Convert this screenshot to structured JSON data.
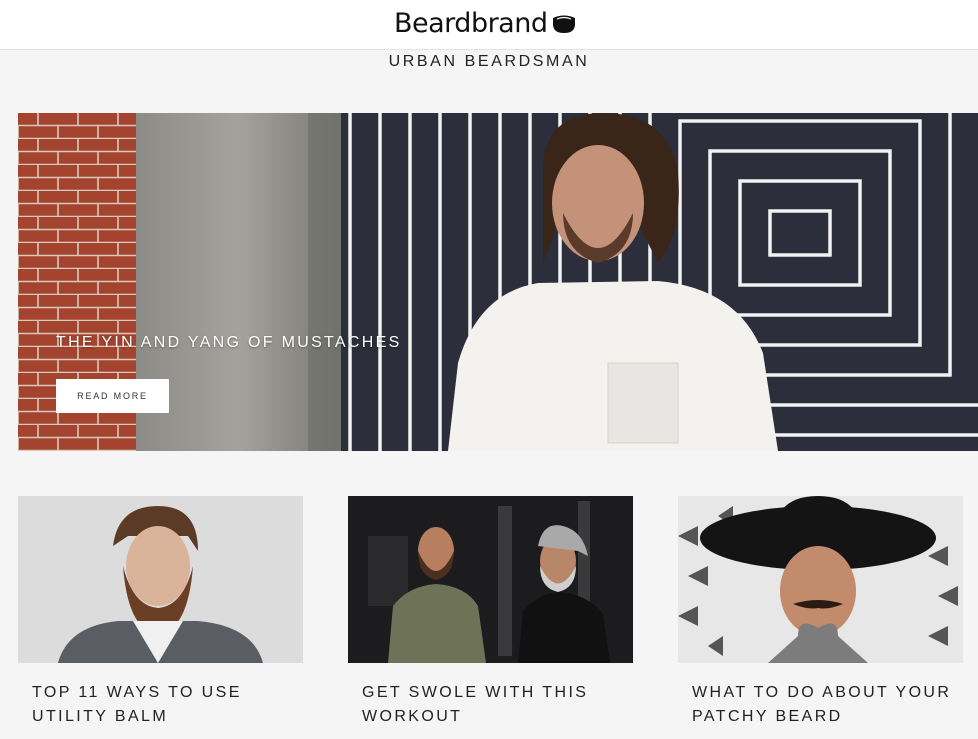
{
  "brand": {
    "name": "Beardbrand",
    "logo_icon": "beard-logo-icon"
  },
  "blog": {
    "title": "URBAN BEARDSMAN"
  },
  "hero": {
    "title": "THE YIN AND YANG OF MUSTACHES",
    "button_label": "READ MORE"
  },
  "posts": [
    {
      "title": "TOP 11 WAYS TO USE UTILITY BALM"
    },
    {
      "title": "GET SWOLE WITH THIS WORKOUT"
    },
    {
      "title": "WHAT TO DO ABOUT YOUR PATCHY BEARD"
    }
  ],
  "colors": {
    "background": "#f5f5f5",
    "header": "#ffffff",
    "text": "#222222",
    "hero_panel": "#2c2f3b"
  }
}
